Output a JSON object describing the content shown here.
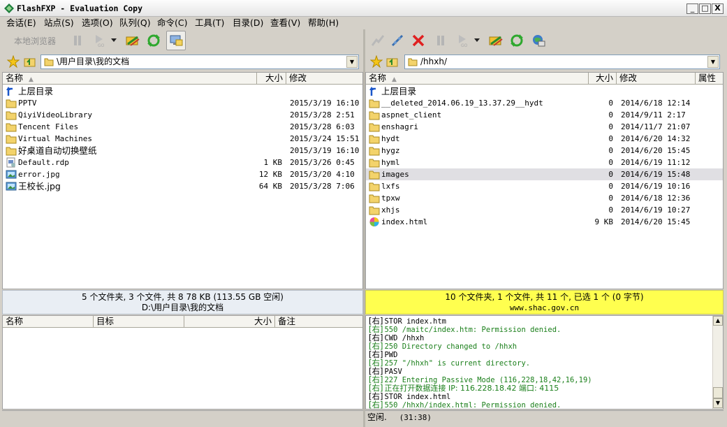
{
  "window": {
    "title": "FlashFXP - Evaluation Copy",
    "minimize": "_",
    "maximize": "□",
    "close": "X"
  },
  "menu": [
    "会话(E)",
    "站点(S)",
    "选项(O)",
    "队列(Q)",
    "命令(C)",
    "工具(T)",
    "目录(D)",
    "查看(V)",
    "帮助(H)"
  ],
  "left_toolbar": {
    "local_browser_label": "本地浏览器"
  },
  "left_path": "\\用户目录\\我的文档",
  "right_path": "/hhxh/",
  "left_columns": {
    "name": "名称",
    "size": "大小",
    "modified": "修改"
  },
  "right_columns": {
    "name": "名称",
    "size": "大小",
    "modified": "修改",
    "attributes": "属性"
  },
  "left_files": [
    {
      "icon": "up-folder-icon",
      "name": "上层目录",
      "size": "",
      "date": ""
    },
    {
      "icon": "folder-icon",
      "name": "PPTV",
      "size": "",
      "date": "2015/3/19 16:10"
    },
    {
      "icon": "folder-icon",
      "name": "QiyiVideoLibrary",
      "size": "",
      "date": "2015/3/28 2:51"
    },
    {
      "icon": "folder-icon",
      "name": "Tencent Files",
      "size": "",
      "date": "2015/3/28 6:03"
    },
    {
      "icon": "folder-icon",
      "name": "Virtual Machines",
      "size": "",
      "date": "2015/3/24 15:51"
    },
    {
      "icon": "folder-icon",
      "name": "好桌道自动切换壁纸",
      "size": "",
      "date": "2015/3/19 16:10"
    },
    {
      "icon": "rdp-icon",
      "name": "Default.rdp",
      "size": "1 KB",
      "date": "2015/3/26 0:45"
    },
    {
      "icon": "image-icon",
      "name": "error.jpg",
      "size": "12 KB",
      "date": "2015/3/20 4:10"
    },
    {
      "icon": "image-icon",
      "name": "王校长.jpg",
      "size": "64 KB",
      "date": "2015/3/28 7:06"
    }
  ],
  "right_files": [
    {
      "icon": "up-folder-icon",
      "name": "上层目录",
      "size": "",
      "date": ""
    },
    {
      "icon": "folder-icon",
      "name": "__deleted_2014.06.19_13.37.29__hydt",
      "size": "0",
      "date": "2014/6/18 12:14"
    },
    {
      "icon": "folder-icon",
      "name": "aspnet_client",
      "size": "0",
      "date": "2014/9/11 2:17"
    },
    {
      "icon": "folder-icon",
      "name": "enshagri",
      "size": "0",
      "date": "2014/11/7 21:07"
    },
    {
      "icon": "folder-icon",
      "name": "hydt",
      "size": "0",
      "date": "2014/6/20 14:32"
    },
    {
      "icon": "folder-icon",
      "name": "hygz",
      "size": "0",
      "date": "2014/6/20 15:45"
    },
    {
      "icon": "folder-icon",
      "name": "hyml",
      "size": "0",
      "date": "2014/6/19 11:12"
    },
    {
      "icon": "folder-icon",
      "name": "images",
      "size": "0",
      "date": "2014/6/19 15:48",
      "selected": true
    },
    {
      "icon": "folder-icon",
      "name": "lxfs",
      "size": "0",
      "date": "2014/6/19 10:16"
    },
    {
      "icon": "folder-icon",
      "name": "tpxw",
      "size": "0",
      "date": "2014/6/18 12:36"
    },
    {
      "icon": "folder-icon",
      "name": "xhjs",
      "size": "0",
      "date": "2014/6/19 10:27"
    },
    {
      "icon": "html-icon",
      "name": "index.html",
      "size": "9 KB",
      "date": "2014/6/20 15:45"
    }
  ],
  "left_status": {
    "line1": "5 个文件夹, 3 个文件, 共 8 78 KB (113.55 GB 空闲)",
    "line2": "D:\\用户目录\\我的文档"
  },
  "right_status": {
    "line1": "10 个文件夹, 1 个文件, 共 11 个, 已选 1 个 (0 字节)",
    "line2": "www.shac.gov.cn"
  },
  "queue_columns": {
    "name": "名称",
    "target": "目标",
    "size": "大小",
    "note": "备注"
  },
  "log_lines": [
    {
      "prefix": "[右]",
      "text": "STOR index.htm",
      "color": "black"
    },
    {
      "prefix": "[右]",
      "text": "550 /maitc/index.htm: Permission denied.",
      "color": "green"
    },
    {
      "prefix": "[右]",
      "text": "CWD /hhxh",
      "color": "black"
    },
    {
      "prefix": "[右]",
      "text": "250 Directory changed to /hhxh",
      "color": "green"
    },
    {
      "prefix": "[右]",
      "text": "PWD",
      "color": "black"
    },
    {
      "prefix": "[右]",
      "text": "257 \"/hhxh\" is current directory.",
      "color": "green"
    },
    {
      "prefix": "[右]",
      "text": "PASV",
      "color": "black"
    },
    {
      "prefix": "[右]",
      "text": "227 Entering Passive Mode (116,228,18,42,16,19)",
      "color": "green"
    },
    {
      "prefix": "[右]",
      "text": "正在打开数据连接 IP: 116.228.18.42 端口: 4115",
      "color": "green"
    },
    {
      "prefix": "[右]",
      "text": "STOR index.html",
      "color": "black"
    },
    {
      "prefix": "[右]",
      "text": "550 /hhxh/index.html: Permission denied.",
      "color": "green"
    }
  ],
  "bottom_status": {
    "state": "空闲.",
    "time": "(31:38)"
  },
  "colors": {
    "left_status_bg": "#e9eef4",
    "right_status_bg": "#ffff4f",
    "log_green": "#1a7f1a",
    "selected_row": "#e0dfe3"
  }
}
